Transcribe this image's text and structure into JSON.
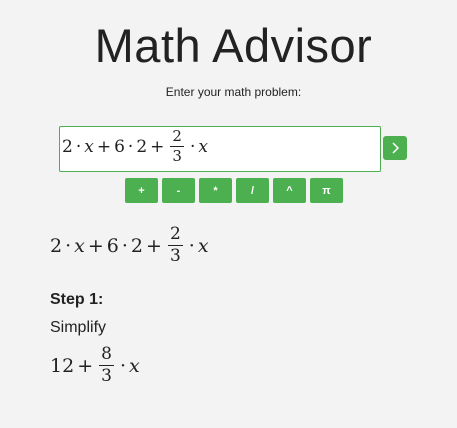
{
  "header": {
    "title": "Math Advisor",
    "prompt": "Enter your math problem:"
  },
  "input": {
    "tokens": {
      "t1": "2",
      "op1": "·",
      "t2": "x",
      "op2": "+",
      "t3": "6",
      "op3": "·",
      "t4": "2",
      "op4": "+",
      "frac_num": "2",
      "frac_den": "3",
      "op5": "·",
      "t5": "x"
    }
  },
  "submit": {
    "icon": "chevron-right-icon",
    "color": "#4caf50"
  },
  "keypad": {
    "keys": [
      "+",
      "-",
      "*",
      "/",
      "^",
      "π"
    ],
    "color": "#4caf50"
  },
  "expression": {
    "t1": "2",
    "op1": "·",
    "t2": "x",
    "op2": "+",
    "t3": "6",
    "op3": "·",
    "t4": "2",
    "op4": "+",
    "frac_num": "2",
    "frac_den": "3",
    "op5": "·",
    "t5": "x"
  },
  "steps": [
    {
      "title": "Step 1:",
      "description": "Simplify",
      "result": {
        "t1": "12",
        "op1": "+",
        "frac_num": "8",
        "frac_den": "3",
        "op2": "·",
        "t2": "x"
      }
    }
  ]
}
